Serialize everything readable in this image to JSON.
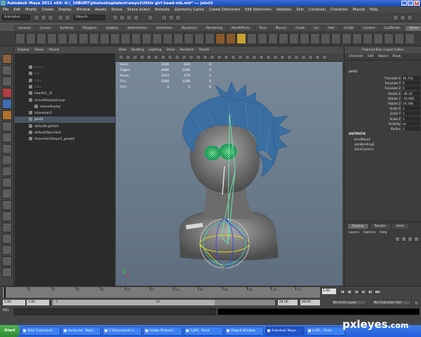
{
  "window": {
    "title": "Autodesk Maya 2011 x64: G:\\_10BURT\\photoshoptalent\\ways2\\little girl head-mb.mb*  ---  joint2",
    "controls": [
      "_",
      "□",
      "×"
    ]
  },
  "menubar": [
    "File",
    "Edit",
    "Modify",
    "Create",
    "Display",
    "Window",
    "Assets",
    "Shave",
    "Shave Select",
    "Animate",
    "Geometry Cache",
    "Create Deformers",
    "Edit Deformers",
    "Skeleton",
    "Skin",
    "Constrain",
    "Character",
    "Muscle",
    "Help"
  ],
  "statusline": {
    "mode": "Animation",
    "object_field": "Objects"
  },
  "shelf": {
    "tabs": [
      "General",
      "Curves",
      "Surfaces",
      "Polygons",
      "Subdivs",
      "Deformation",
      "Animation",
      "Dynamics",
      "Rendering",
      "PaintEffects",
      "Toon",
      "Muscle",
      "Fluids",
      "Fur",
      "Hair",
      "nCloth",
      "Custom",
      "GoZBrush",
      "Shave"
    ],
    "active_tab": "Shave"
  },
  "outliner": {
    "menu": [
      "Display",
      "Show",
      "Panels"
    ],
    "items": [
      {
        "label": "persp",
        "state": "dim"
      },
      {
        "label": "top",
        "state": "dim"
      },
      {
        "label": "front",
        "state": "dim"
      },
      {
        "label": "side",
        "state": "dim"
      },
      {
        "label": "head03__N",
        "state": "normal"
      },
      {
        "label": "shaveDisplayGroup",
        "state": "normal"
      },
      {
        "label": "shavedisplay",
        "state": "normal"
      },
      {
        "label": "shaveHair1",
        "state": "normal"
      },
      {
        "label": "joint1",
        "state": "selected"
      },
      {
        "label": "defaultLightSet",
        "state": "normal"
      },
      {
        "label": "defaultObjectSet",
        "state": "normal"
      },
      {
        "label": "shaveHairShape1_growth",
        "state": "normal"
      }
    ]
  },
  "viewport": {
    "menu": [
      "View",
      "Shading",
      "Lighting",
      "Show",
      "Renderer",
      "Panels"
    ],
    "hud": [
      {
        "label": "Verts:",
        "a": "2226",
        "b": "639",
        "c": "0"
      },
      {
        "label": "Edges:",
        "a": "4466",
        "b": "1300",
        "c": "0"
      },
      {
        "label": "Faces:",
        "a": "2224",
        "b": "679",
        "c": "0"
      },
      {
        "label": "Tris:",
        "a": "4388",
        "b": "1248",
        "c": "0"
      },
      {
        "label": "UVs:",
        "a": "0",
        "b": "0",
        "c": "0"
      }
    ],
    "colors": {
      "hair": "#3a6ea0",
      "glasses": "#3cf08a",
      "joint": "#d8d8d8",
      "ring_yellow": "#e2d21a",
      "ring_blue": "#3b4bd8",
      "ring_cyan": "#2ad4c8"
    }
  },
  "channelbox": {
    "title": "Channel Box / Layer Editor",
    "menu": [
      "Channels",
      "Edit",
      "Object",
      "Show"
    ],
    "object": "joint2",
    "attributes": [
      {
        "name": "Translate X",
        "value": "46.733"
      },
      {
        "name": "Translate Y",
        "value": "0"
      },
      {
        "name": "Translate Z",
        "value": "0"
      },
      {
        "name": "Rotate X",
        "value": "-46.16"
      },
      {
        "name": "Rotate Y",
        "value": "-24.985"
      },
      {
        "name": "Rotate Z",
        "value": "14.168"
      },
      {
        "name": "Scale X",
        "value": "1"
      },
      {
        "name": "Scale Y",
        "value": "1"
      },
      {
        "name": "Scale Z",
        "value": "1"
      },
      {
        "name": "Visibility",
        "value": "on"
      },
      {
        "name": "Radius",
        "value": "2"
      }
    ],
    "outputs_label": "OUTPUTS",
    "outputs": [
      "bindPose1",
      "skinBinding1",
      "skinCluster1"
    ]
  },
  "layers": {
    "tabs": [
      "Display",
      "Render",
      "Anim"
    ],
    "active_tab": "Display",
    "menu": [
      "Layers",
      "Options",
      "Help"
    ]
  },
  "timeslider": {
    "ticks": [
      "2",
      "4",
      "6",
      "8",
      "10",
      "12",
      "14",
      "16",
      "18",
      "20",
      "22",
      "24"
    ],
    "current_frame": "1.00",
    "playback": [
      "|◀",
      "◀|",
      "◀",
      "▶",
      "▶|",
      "▶▶|"
    ]
  },
  "rangeslider": {
    "start": "1.00",
    "range_start": "1.00",
    "handle_left": "1",
    "handle_right": "24",
    "range_end": "24.00",
    "end": "48.00",
    "anim_layer": "No Anim Layer",
    "character": "No Character Set"
  },
  "cmdline": {
    "label": "MEL"
  },
  "taskbar": {
    "start": "Start",
    "tasks": [
      {
        "label": "Total Command...",
        "active": false
      },
      {
        "label": "zunsa.txt - Note...",
        "active": false
      },
      {
        "label": "C:\\Documents a...",
        "active": false
      },
      {
        "label": "Adobe Photosh...",
        "active": false
      },
      {
        "label": "5.JPG - Paint",
        "active": false
      },
      {
        "label": "Output Window",
        "active": false
      },
      {
        "label": "Autodesk Maya ...",
        "active": true
      },
      {
        "label": "4.JPG - Paint",
        "active": false
      }
    ]
  },
  "watermark": {
    "main": "pxleyes",
    "suffix": ".com"
  }
}
